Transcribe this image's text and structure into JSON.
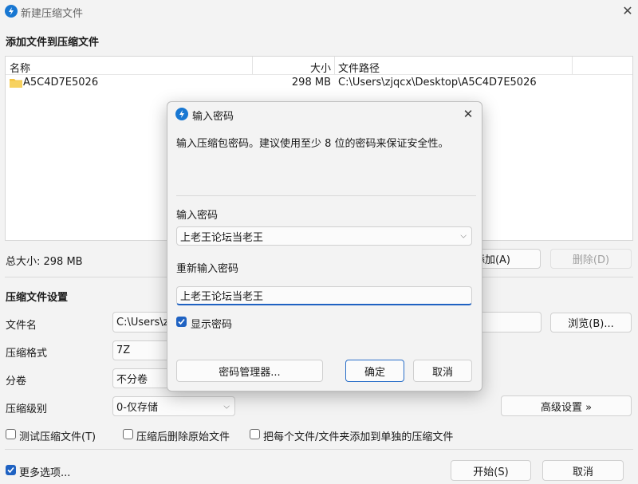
{
  "window": {
    "title": "新建压缩文件",
    "close_glyph": "✕",
    "icon": "bandizip-icon"
  },
  "add_section": {
    "title": "添加文件到压缩文件",
    "columns": {
      "name": "名称",
      "size": "大小",
      "path": "文件路径"
    },
    "rows": [
      {
        "name": "A5C4D7E5026",
        "size": "298 MB",
        "path": "C:\\Users\\zjqcx\\Desktop\\A5C4D7E5026",
        "icon": "folder-icon"
      }
    ],
    "total_size": "总大小: 298 MB",
    "add_button": "添加(A)",
    "delete_button": "删除(D)"
  },
  "settings": {
    "title": "压缩文件设置",
    "filename_label": "文件名",
    "filename_value": "C:\\Users\\zj",
    "browse_button": "浏览(B)...",
    "format_label": "压缩格式",
    "format_value": "7Z",
    "split_label": "分卷",
    "split_value": "不分卷",
    "level_label": "压缩级别",
    "level_value": "0-仅存储",
    "advanced_button": "高级设置 »",
    "test_checkbox": "测试压缩文件(T)",
    "delete_original_checkbox": "压缩后删除原始文件",
    "separate_checkbox": "把每个文件/文件夹添加到单独的压缩文件"
  },
  "footer": {
    "more_options": "更多选项...",
    "start_button": "开始(S)",
    "cancel_button": "取消"
  },
  "dialog": {
    "title": "输入密码",
    "close_glyph": "✕",
    "description": "输入压缩包密码。建议使用至少 8 位的密码来保证安全性。",
    "password_label": "输入密码",
    "password_value": "上老王论坛当老王",
    "reenter_label": "重新输入密码",
    "reenter_value": "上老王论坛当老王",
    "show_password": "显示密码",
    "manager_button": "密码管理器...",
    "ok_button": "确定",
    "cancel_button": "取消"
  },
  "colors": {
    "accent": "#1f62c2",
    "background": "#f3f3f3",
    "folder": "#f4c542"
  }
}
